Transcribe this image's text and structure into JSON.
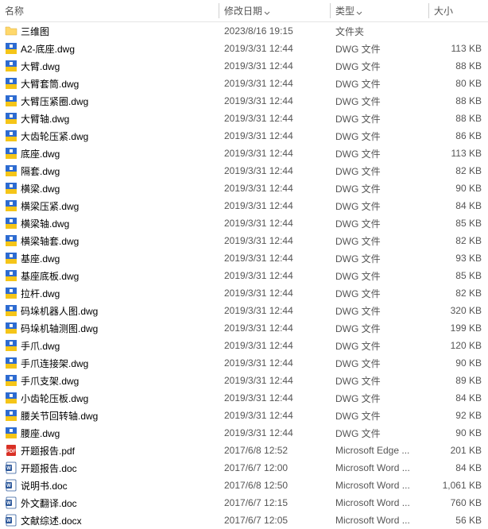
{
  "columns": {
    "name": "名称",
    "date": "修改日期",
    "type": "类型",
    "size": "大小"
  },
  "icons": {
    "folder": "folder",
    "dwg": "dwg",
    "pdf": "pdf",
    "doc": "doc",
    "docx": "docx"
  },
  "rows": [
    {
      "icon": "folder",
      "name": "三维图",
      "date": "2023/8/16 19:15",
      "type": "文件夹",
      "size": ""
    },
    {
      "icon": "dwg",
      "name": "A2-底座.dwg",
      "date": "2019/3/31 12:44",
      "type": "DWG 文件",
      "size": "113 KB"
    },
    {
      "icon": "dwg",
      "name": "大臂.dwg",
      "date": "2019/3/31 12:44",
      "type": "DWG 文件",
      "size": "88 KB"
    },
    {
      "icon": "dwg",
      "name": "大臂套筒.dwg",
      "date": "2019/3/31 12:44",
      "type": "DWG 文件",
      "size": "80 KB"
    },
    {
      "icon": "dwg",
      "name": "大臂压紧圈.dwg",
      "date": "2019/3/31 12:44",
      "type": "DWG 文件",
      "size": "88 KB"
    },
    {
      "icon": "dwg",
      "name": "大臂轴.dwg",
      "date": "2019/3/31 12:44",
      "type": "DWG 文件",
      "size": "88 KB"
    },
    {
      "icon": "dwg",
      "name": "大齿轮压紧.dwg",
      "date": "2019/3/31 12:44",
      "type": "DWG 文件",
      "size": "86 KB"
    },
    {
      "icon": "dwg",
      "name": "底座.dwg",
      "date": "2019/3/31 12:44",
      "type": "DWG 文件",
      "size": "113 KB"
    },
    {
      "icon": "dwg",
      "name": "隔套.dwg",
      "date": "2019/3/31 12:44",
      "type": "DWG 文件",
      "size": "82 KB"
    },
    {
      "icon": "dwg",
      "name": "横梁.dwg",
      "date": "2019/3/31 12:44",
      "type": "DWG 文件",
      "size": "90 KB"
    },
    {
      "icon": "dwg",
      "name": "横梁压紧.dwg",
      "date": "2019/3/31 12:44",
      "type": "DWG 文件",
      "size": "84 KB"
    },
    {
      "icon": "dwg",
      "name": "横梁轴.dwg",
      "date": "2019/3/31 12:44",
      "type": "DWG 文件",
      "size": "85 KB"
    },
    {
      "icon": "dwg",
      "name": "横梁轴套.dwg",
      "date": "2019/3/31 12:44",
      "type": "DWG 文件",
      "size": "82 KB"
    },
    {
      "icon": "dwg",
      "name": "基座.dwg",
      "date": "2019/3/31 12:44",
      "type": "DWG 文件",
      "size": "93 KB"
    },
    {
      "icon": "dwg",
      "name": "基座底板.dwg",
      "date": "2019/3/31 12:44",
      "type": "DWG 文件",
      "size": "85 KB"
    },
    {
      "icon": "dwg",
      "name": "拉杆.dwg",
      "date": "2019/3/31 12:44",
      "type": "DWG 文件",
      "size": "82 KB"
    },
    {
      "icon": "dwg",
      "name": "码垛机器人图.dwg",
      "date": "2019/3/31 12:44",
      "type": "DWG 文件",
      "size": "320 KB"
    },
    {
      "icon": "dwg",
      "name": "码垛机轴测图.dwg",
      "date": "2019/3/31 12:44",
      "type": "DWG 文件",
      "size": "199 KB"
    },
    {
      "icon": "dwg",
      "name": "手爪.dwg",
      "date": "2019/3/31 12:44",
      "type": "DWG 文件",
      "size": "120 KB"
    },
    {
      "icon": "dwg",
      "name": "手爪连接架.dwg",
      "date": "2019/3/31 12:44",
      "type": "DWG 文件",
      "size": "90 KB"
    },
    {
      "icon": "dwg",
      "name": "手爪支架.dwg",
      "date": "2019/3/31 12:44",
      "type": "DWG 文件",
      "size": "89 KB"
    },
    {
      "icon": "dwg",
      "name": "小齿轮压板.dwg",
      "date": "2019/3/31 12:44",
      "type": "DWG 文件",
      "size": "84 KB"
    },
    {
      "icon": "dwg",
      "name": "腰关节回转轴.dwg",
      "date": "2019/3/31 12:44",
      "type": "DWG 文件",
      "size": "92 KB"
    },
    {
      "icon": "dwg",
      "name": "腰座.dwg",
      "date": "2019/3/31 12:44",
      "type": "DWG 文件",
      "size": "90 KB"
    },
    {
      "icon": "pdf",
      "name": "开题报告.pdf",
      "date": "2017/6/8 12:52",
      "type": "Microsoft Edge ...",
      "size": "201 KB"
    },
    {
      "icon": "doc",
      "name": "开题报告.doc",
      "date": "2017/6/7 12:00",
      "type": "Microsoft Word ...",
      "size": "84 KB"
    },
    {
      "icon": "doc",
      "name": "说明书.doc",
      "date": "2017/6/8 12:50",
      "type": "Microsoft Word ...",
      "size": "1,061 KB"
    },
    {
      "icon": "doc",
      "name": "外文翻译.doc",
      "date": "2017/6/7 12:15",
      "type": "Microsoft Word ...",
      "size": "760 KB"
    },
    {
      "icon": "docx",
      "name": "文献综述.docx",
      "date": "2017/6/7 12:05",
      "type": "Microsoft Word ...",
      "size": "56 KB"
    }
  ]
}
